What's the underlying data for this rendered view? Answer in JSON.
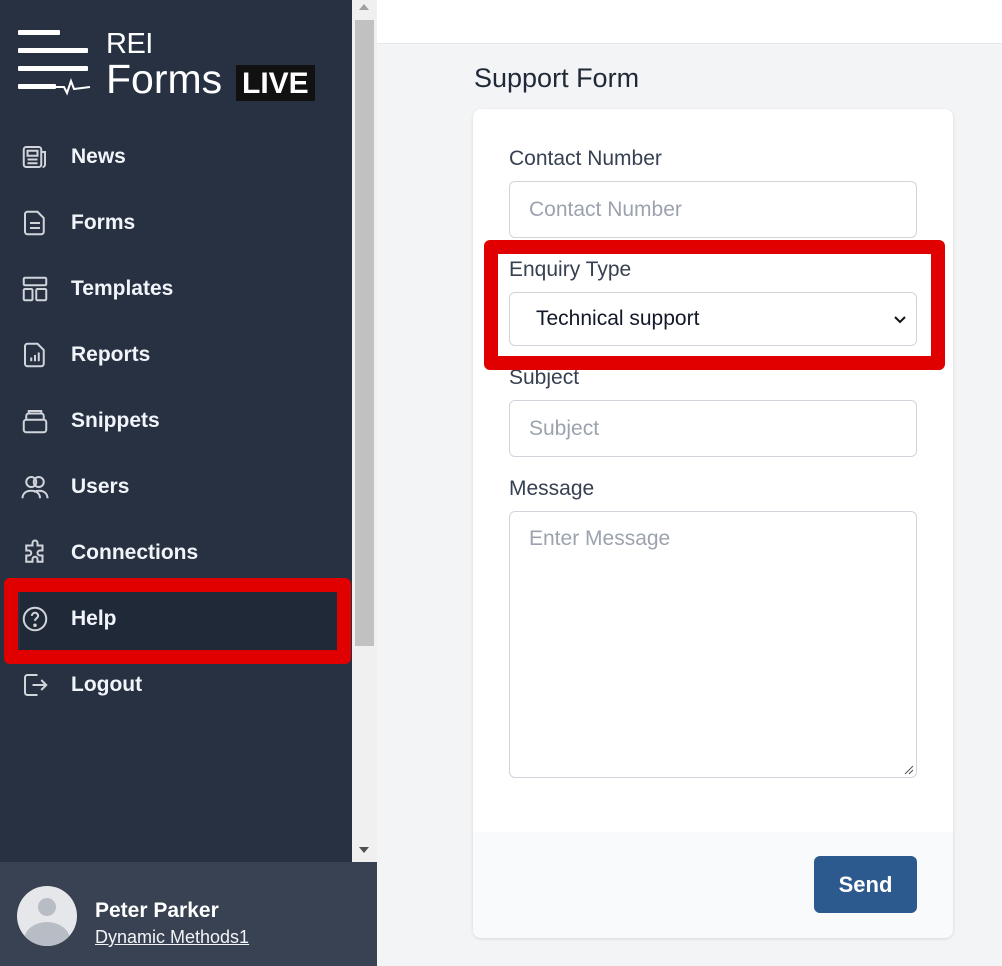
{
  "brand": {
    "line1": "REI",
    "line2": "Forms",
    "badge": "LIVE"
  },
  "nav": [
    {
      "label": "News",
      "icon": "newspaper-icon"
    },
    {
      "label": "Forms",
      "icon": "document-icon"
    },
    {
      "label": "Templates",
      "icon": "template-icon"
    },
    {
      "label": "Reports",
      "icon": "report-icon"
    },
    {
      "label": "Snippets",
      "icon": "stack-icon"
    },
    {
      "label": "Users",
      "icon": "users-icon"
    },
    {
      "label": "Connections",
      "icon": "puzzle-icon"
    },
    {
      "label": "Help",
      "icon": "help-circle-icon"
    },
    {
      "label": "Logout",
      "icon": "logout-icon"
    }
  ],
  "user": {
    "name": "Peter Parker",
    "org": "Dynamic Methods1"
  },
  "form": {
    "title": "Support Form",
    "contact_label": "Contact Number",
    "contact_placeholder": "Contact Number",
    "enquiry_label": "Enquiry Type",
    "enquiry_value": "Technical support",
    "subject_label": "Subject",
    "subject_placeholder": "Subject",
    "message_label": "Message",
    "message_placeholder": "Enter Message",
    "send_label": "Send"
  },
  "colors": {
    "sidebar": "#273142",
    "highlight": "#e00000",
    "primary_button": "#2d5a8e"
  }
}
